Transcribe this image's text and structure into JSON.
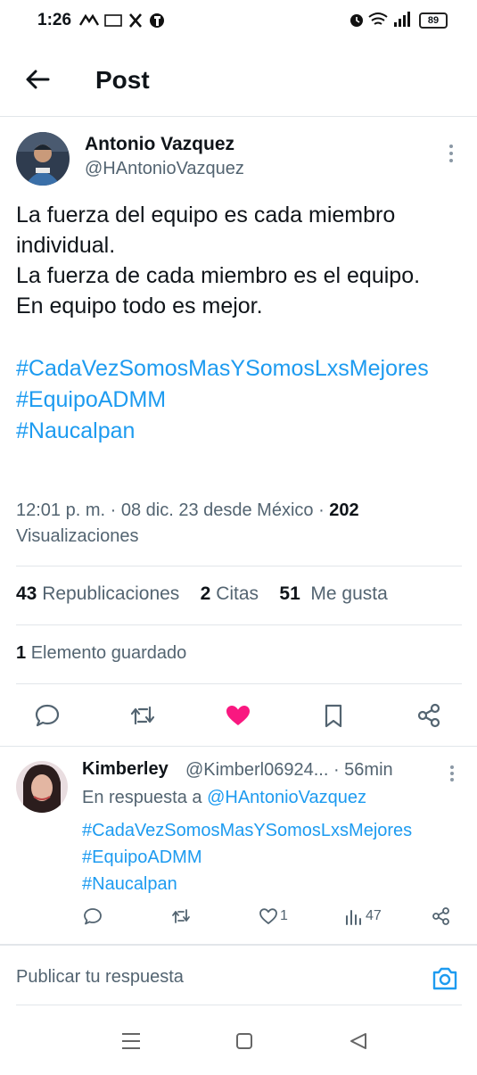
{
  "status_bar": {
    "time": "1:26",
    "battery": "89"
  },
  "header": {
    "title": "Post"
  },
  "post": {
    "author_name": "Antonio Vazquez",
    "author_handle": "@HAntonioVazquez",
    "text": "La fuerza del equipo es cada miembro individual.\nLa fuerza de cada miembro es el equipo.\nEn equipo todo es mejor.",
    "hashtags": [
      "#CadaVezSomosMasYSomosLxsMejores",
      "#EquipoADMM",
      "#Naucalpan"
    ],
    "timestamp": "12:01 p. m. · 08 dic. 23 desde México · ",
    "views_count": "202",
    "views_label": "Visualizaciones",
    "reposts_count": "43",
    "reposts_label": "Republicaciones",
    "quotes_count": "2",
    "quotes_label": "Citas",
    "likes_count": "51",
    "likes_label": "Me gusta",
    "bookmarks_count": "1",
    "bookmarks_label": "Elemento guardado",
    "liked": true
  },
  "reply": {
    "author_name": "Kimberley",
    "author_handle": "@Kimberl06924...",
    "time": "· 56min",
    "in_reply_prefix": "En respuesta a ",
    "in_reply_handle": "@HAntonioVazquez",
    "hashtags": [
      "#CadaVezSomosMasYSomosLxsMejores",
      "#EquipoADMM",
      "#Naucalpan"
    ],
    "likes": "1",
    "views": "47"
  },
  "composer": {
    "placeholder": "Publicar tu respuesta"
  },
  "colors": {
    "accent": "#1d9bf0",
    "like": "#f91880",
    "text": "#0f1419",
    "muted": "#536471"
  },
  "icons": [
    "back-arrow-icon",
    "more-vertical-icon",
    "reply-icon",
    "repost-icon",
    "heart-icon",
    "bookmark-icon",
    "share-icon",
    "views-icon",
    "camera-icon"
  ]
}
